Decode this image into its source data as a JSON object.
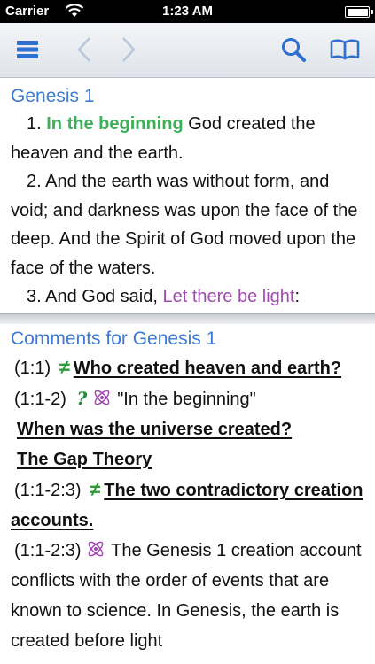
{
  "status": {
    "carrier": "Carrier",
    "time": "1:23 AM"
  },
  "toolbar": {
    "icons": [
      "menu-icon",
      "back-arrow-icon",
      "forward-arrow-icon",
      "search-icon",
      "book-icon"
    ],
    "accent": "#3b7ad6"
  },
  "bible": {
    "heading": "Genesis 1",
    "verse1": {
      "num": "1.",
      "highlight": "In the beginning",
      "rest": " God created the heaven and the earth."
    },
    "verse2": {
      "num": "2.",
      "text": " And the earth was without form, and void; and darkness was upon the face of the deep. And the Spirit of God moved upon the face of the waters."
    },
    "verse3": {
      "num": "3.",
      "text": " And God said, ",
      "highlight": "Let there be light",
      "rest": ":"
    }
  },
  "comments": {
    "heading": "Comments for Genesis 1",
    "c1": {
      "ref": "(1:1)",
      "mark": "≠",
      "title": "Who created heaven and earth?"
    },
    "c2": {
      "ref": "(1:1-2)",
      "mark": "?",
      "quote": "\"In the beginning\""
    },
    "c3": {
      "title": "When was the universe created?"
    },
    "c4": {
      "title": "The Gap Theory"
    },
    "c5": {
      "ref": "(1:1-2:3)",
      "mark": "≠",
      "title": "The two contradictory creation accounts."
    },
    "c6": {
      "ref": "(1:1-2:3)",
      "text": "The Genesis 1 creation account conflicts with the order of events that are known to science. In Genesis, the earth is created before light"
    }
  },
  "colors": {
    "heading_blue": "#3b7ad6",
    "highlight_green": "#3fae5a",
    "highlight_purple": "#a04bb0"
  }
}
